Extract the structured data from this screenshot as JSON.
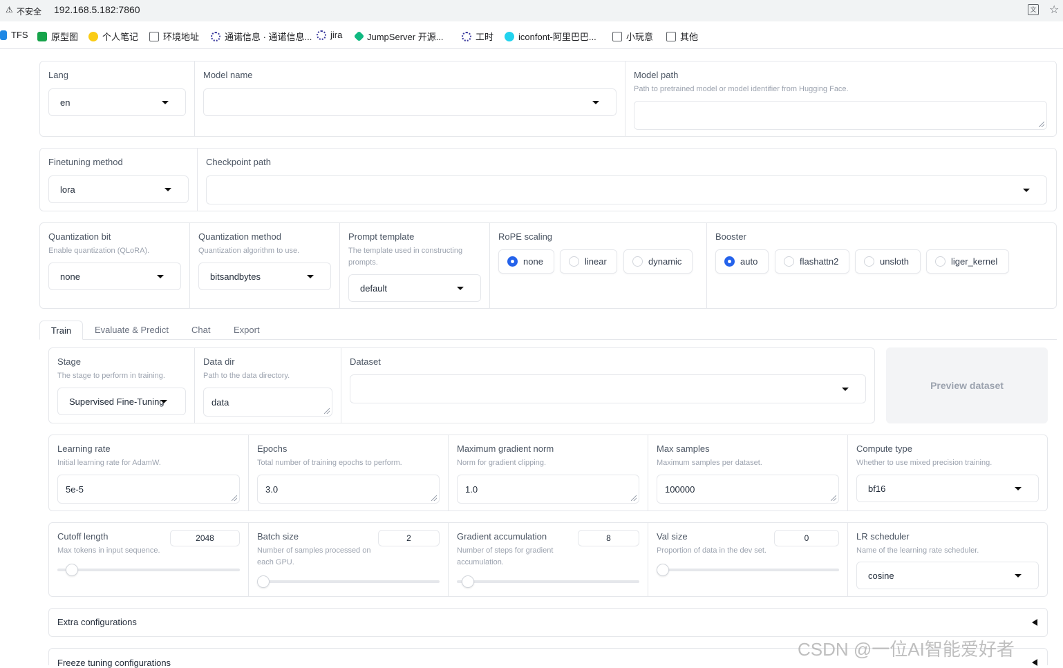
{
  "browser": {
    "security_label": "不安全",
    "url": "192.168.5.182:7860",
    "bookmarks": [
      "TFS",
      "原型图",
      "个人笔记",
      "环境地址",
      "通诺信息 · 通诺信息...",
      "jira",
      "JumpServer 开源...",
      "工时",
      "iconfont-阿里巴巴...",
      "小玩意",
      "其他"
    ]
  },
  "top": {
    "lang": {
      "label": "Lang",
      "value": "en"
    },
    "model_name": {
      "label": "Model name",
      "value": ""
    },
    "model_path": {
      "label": "Model path",
      "info": "Path to pretrained model or model identifier from Hugging Face.",
      "value": ""
    }
  },
  "row2": {
    "finetuning": {
      "label": "Finetuning method",
      "value": "lora"
    },
    "checkpoint": {
      "label": "Checkpoint path",
      "value": ""
    }
  },
  "row3": {
    "quant_bit": {
      "label": "Quantization bit",
      "info": "Enable quantization (QLoRA).",
      "value": "none"
    },
    "quant_method": {
      "label": "Quantization method",
      "info": "Quantization algorithm to use.",
      "value": "bitsandbytes"
    },
    "prompt_template": {
      "label": "Prompt template",
      "info": "The template used in constructing prompts.",
      "value": "default"
    },
    "rope": {
      "label": "RoPE scaling",
      "options": [
        "none",
        "linear",
        "dynamic"
      ],
      "selected": "none"
    },
    "booster": {
      "label": "Booster",
      "options": [
        "auto",
        "flashattn2",
        "unsloth",
        "liger_kernel"
      ],
      "selected": "auto"
    }
  },
  "tabs": [
    "Train",
    "Evaluate & Predict",
    "Chat",
    "Export"
  ],
  "active_tab": "Train",
  "train": {
    "stage": {
      "label": "Stage",
      "info": "The stage to perform in training.",
      "value": "Supervised Fine-Tuning"
    },
    "data_dir": {
      "label": "Data dir",
      "info": "Path to the data directory.",
      "value": "data"
    },
    "dataset": {
      "label": "Dataset",
      "value": ""
    },
    "preview_label": "Preview dataset",
    "learning_rate": {
      "label": "Learning rate",
      "info": "Initial learning rate for AdamW.",
      "value": "5e-5"
    },
    "epochs": {
      "label": "Epochs",
      "info": "Total number of training epochs to perform.",
      "value": "3.0"
    },
    "max_grad_norm": {
      "label": "Maximum gradient norm",
      "info": "Norm for gradient clipping.",
      "value": "1.0"
    },
    "max_samples": {
      "label": "Max samples",
      "info": "Maximum samples per dataset.",
      "value": "100000"
    },
    "compute_type": {
      "label": "Compute type",
      "info": "Whether to use mixed precision training.",
      "value": "bf16"
    },
    "cutoff_len": {
      "label": "Cutoff length",
      "info": "Max tokens in input sequence.",
      "value": "2048",
      "fraction": 0.05
    },
    "batch_size": {
      "label": "Batch size",
      "info": "Number of samples processed on each GPU.",
      "value": "2",
      "fraction": 0.0
    },
    "grad_accum": {
      "label": "Gradient accumulation",
      "info": "Number of steps for gradient accumulation.",
      "value": "8",
      "fraction": 0.03
    },
    "val_size": {
      "label": "Val size",
      "info": "Proportion of data in the dev set.",
      "value": "0",
      "fraction": 0.0
    },
    "lr_scheduler": {
      "label": "LR scheduler",
      "info": "Name of the learning rate scheduler.",
      "value": "cosine"
    },
    "extra_label": "Extra configurations",
    "freeze_label": "Freeze tuning configurations"
  },
  "watermark": "CSDN @一位AI智能爱好者"
}
